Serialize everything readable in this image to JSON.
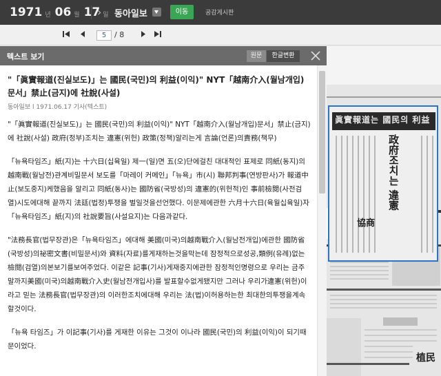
{
  "topbar": {
    "year": "1971",
    "year_unit": "년",
    "month": "06",
    "month_unit": "월",
    "day": "17",
    "day_unit": "일",
    "newspaper": "동아일보",
    "move_button": "이동",
    "board_link": "공감게시판"
  },
  "pagination": {
    "current_page": "5",
    "total_label": "/ 8"
  },
  "text_panel": {
    "title": "텍스트 보기",
    "tab_original": "원문",
    "tab_korean": "한글변환",
    "headline": "\"「眞實報道(진실보도)」는 國民(국민)의 利益(이익)\" NYT「越南介入(월남개입)문서」禁止(금지)에 社說(사설)",
    "meta": "동아일보 l 1971.06.17 기사(텍스트)",
    "paragraphs": [
      "\"「眞實報道(진실보도)」는 國民(국민)의 利益(이익)\" NYT「越南介入(월남개입)문서」禁止(금지)에 社說(사설) 政府(정부)조치는 違憲(위헌) 政策(정책)알리는게 言論(언론)의責務(책무)",
      "「뉴욕타임즈」紙(지)는 十六日(십육일) 제一(일)면 五(오)단에걸친 대대적인 표제로 同紙(동지)의 越南戰(월남전)관계비밀문서 보도를「마레이 커메인」「뉴욕」市(시) 聯邦判事(연방판사)가 報道中止(보도중지)케했음을 알리고 同紙(동사)는 國防省(국방성)의 違憲的(위헌적)인 事前檢閱(사전검열)시도에대해 끝까지 法廷(법정)투쟁을 벌일것을선언했다. 이문제에관한 六月十六日(육월십육일)자「뉴욕타임즈」紙(지)의 社說要旨(사설요지)는 다음과같다.",
      "\"法務長官(법무장관)은「뉴욕타임즈」에대해 美國(미국)의越南戰介入(월남전개입)에관한 國防省(국방성)의祕密文書(비밀문서)와 資料(자료)를게재하는것을막는데 잠정적으로성공,類例(유례)없는 檢閱(검열)의본보기를보여주었다. 이같은 記事(기사)게재중지에관한 잠정적인명령으로 우리는 금주말까지美國(미국)의越南戰介入史(월남전개입사)를 발표할수없게됐지만 그러나 우리가違憲(위헌)이라고 믿는 法務長官(법무장관)의 이러한조치에대해 우리는 法(법)이허용하는한 최대한의투쟁을계속할것이다.",
      "「뉴욕 타임즈」가 이記事(기사)를 게재한 이유는 그것이 이나라 國民(국민)의 利益(이익)이 되기때문이었다."
    ]
  },
  "newspaper_image": {
    "banner_text": "眞實報道는 國民의 利益",
    "vertical_headline": "政府조치는 違憲",
    "caption_a": "協商",
    "caption_b": "植民"
  }
}
